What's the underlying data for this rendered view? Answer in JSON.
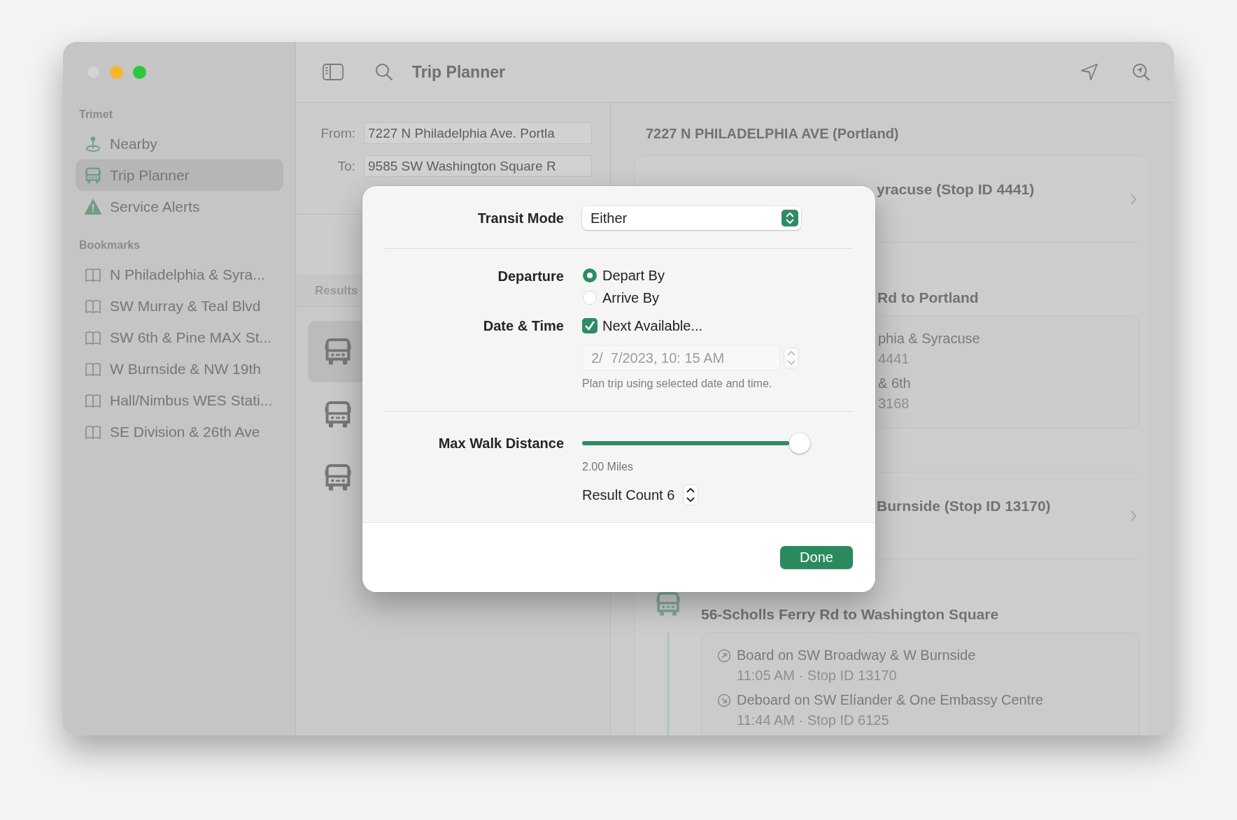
{
  "sidebar": {
    "sections": [
      {
        "title": "Trimet",
        "items": [
          {
            "label": "Nearby",
            "kind": "nearby",
            "selected": false
          },
          {
            "label": "Trip Planner",
            "kind": "trip",
            "selected": true
          },
          {
            "label": "Service Alerts",
            "kind": "alert",
            "selected": false
          }
        ]
      },
      {
        "title": "Bookmarks",
        "items": [
          {
            "label": "N Philadelphia & Syra...",
            "kind": "bookmark",
            "selected": false
          },
          {
            "label": "SW Murray & Teal Blvd",
            "kind": "bookmark",
            "selected": false
          },
          {
            "label": "SW 6th & Pine MAX St...",
            "kind": "bookmark",
            "selected": false
          },
          {
            "label": "W Burnside & NW 19th",
            "kind": "bookmark",
            "selected": false
          },
          {
            "label": "Hall/Nimbus WES Stati...",
            "kind": "bookmark",
            "selected": false
          },
          {
            "label": "SE Division & 26th Ave",
            "kind": "bookmark",
            "selected": false
          }
        ]
      }
    ]
  },
  "toolbar": {
    "title": "Trip Planner"
  },
  "trip_form": {
    "fields": [
      {
        "label": "From:",
        "value": "7227 N Philadelphia Ave. Portla"
      },
      {
        "label": "To:",
        "value": "9585 SW Washington Square R"
      }
    ]
  },
  "results": {
    "header": "Results",
    "rows": [
      {
        "selected": true
      },
      {
        "selected": false
      },
      {
        "selected": false
      }
    ]
  },
  "itinerary": {
    "origin": "7227 N PHILADELPHIA AVE (Portland)",
    "legs": [
      {
        "kind": "step",
        "title": "yracuse (Stop ID 4441)"
      },
      {
        "kind": "ride",
        "title": "Rd to Portland",
        "stops": [
          {
            "name": "phia & Syracuse",
            "detail": "4441"
          },
          {
            "name": "& 6th",
            "detail": "3168"
          }
        ]
      },
      {
        "kind": "step",
        "title": "Burnside (Stop ID 13170)"
      },
      {
        "kind": "ride",
        "title": "56-Scholls Ferry Rd to Washington Square",
        "stops": [
          {
            "kind": "board",
            "name": "Board on SW Broadway & W Burnside",
            "detail": "11:05 AM · Stop ID 13170"
          },
          {
            "kind": "deboard",
            "name": "Deboard on SW Elíander & One Embassy Centre",
            "detail": "11:44 AM · Stop ID 6125"
          }
        ]
      }
    ]
  },
  "options": {
    "transit_mode": {
      "label": "Transit Mode",
      "value": "Either"
    },
    "departure": {
      "label": "Departure",
      "options": [
        {
          "label": "Depart By",
          "selected": true
        },
        {
          "label": "Arrive By",
          "selected": false
        }
      ]
    },
    "date_time": {
      "label": "Date & Time",
      "next_available": {
        "label": "Next Available...",
        "checked": true
      },
      "value": "2/  7/2023, 10: 15 AM",
      "disabled": true,
      "help": "Plan trip using selected date and time."
    },
    "max_walk": {
      "label": "Max Walk Distance",
      "level": 1,
      "reading": "2.00 Miles"
    },
    "result_count": {
      "label": "Result Count 6"
    },
    "done": "Done"
  }
}
